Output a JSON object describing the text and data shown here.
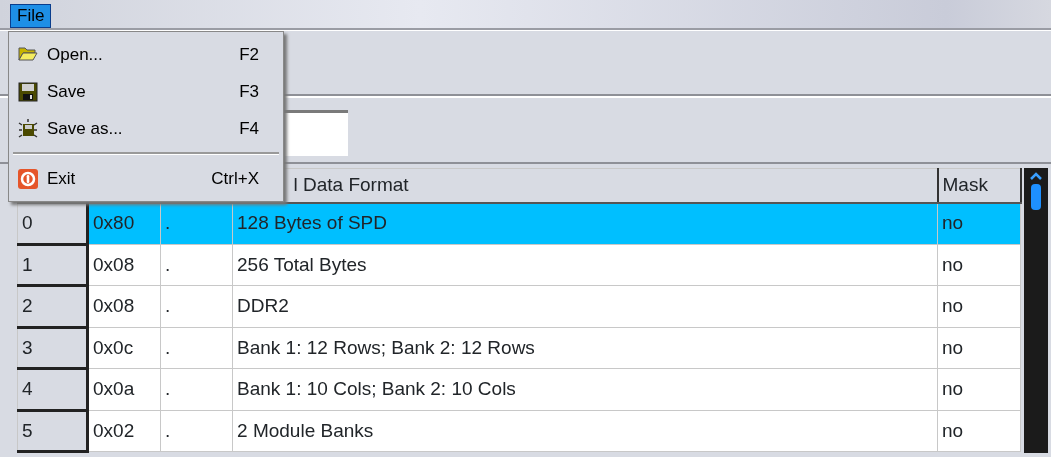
{
  "menubar": [
    {
      "label": "File",
      "selected": true
    }
  ],
  "file_menu": [
    {
      "kind": "open",
      "label": "Open...",
      "shortcut": "F2",
      "separator_before": false
    },
    {
      "kind": "save",
      "label": "Save",
      "shortcut": "F3",
      "separator_before": false
    },
    {
      "kind": "save_as",
      "label": "Save as...",
      "shortcut": "F4",
      "separator_before": false
    },
    {
      "kind": "exit",
      "label": "Exit",
      "shortcut": "Ctrl+X",
      "separator_before": true
    }
  ],
  "table": {
    "columns": [
      "l Data Format",
      "Mask"
    ],
    "rows": [
      {
        "index": "0",
        "hex": "0x80",
        "char": ".",
        "description": "128 Bytes of SPD",
        "mask": "no",
        "selected": true
      },
      {
        "index": "1",
        "hex": "0x08",
        "char": ".",
        "description": "256 Total Bytes",
        "mask": "no",
        "selected": false
      },
      {
        "index": "2",
        "hex": "0x08",
        "char": ".",
        "description": "DDR2",
        "mask": "no",
        "selected": false
      },
      {
        "index": "3",
        "hex": "0x0c",
        "char": ".",
        "description": "Bank 1: 12 Rows; Bank 2: 12 Rows",
        "mask": "no",
        "selected": false
      },
      {
        "index": "4",
        "hex": "0x0a",
        "char": ".",
        "description": "Bank 1: 10 Cols; Bank 2: 10 Cols",
        "mask": "no",
        "selected": false
      },
      {
        "index": "5",
        "hex": "0x02",
        "char": ".",
        "description": "2 Module Banks",
        "mask": "no",
        "selected": false
      }
    ]
  }
}
